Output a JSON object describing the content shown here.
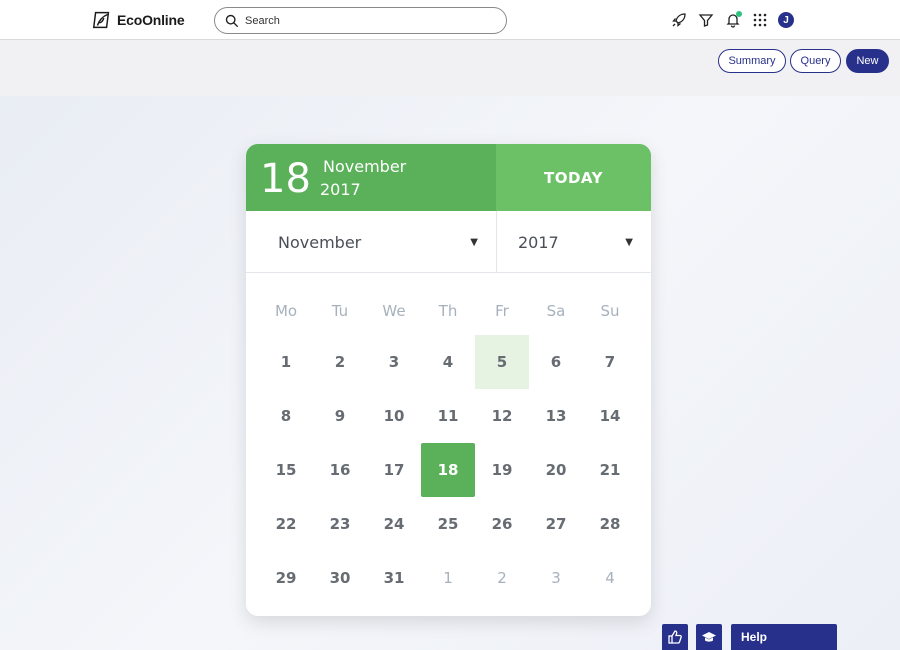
{
  "app": {
    "name": "EcoOnline"
  },
  "search": {
    "placeholder": "Search"
  },
  "topbar": {
    "icons": [
      "rocket-icon",
      "filter-icon",
      "bell-icon",
      "apps-grid-icon"
    ],
    "avatar_initial": "J",
    "notification_color": "#2ec27e"
  },
  "actions": {
    "summary": "Summary",
    "query": "Query",
    "new": "New"
  },
  "calendar": {
    "selected_day": "18",
    "selected_month": "November",
    "selected_year": "2017",
    "today_label": "TODAY",
    "month_select": "November",
    "year_select": "2017",
    "weekdays": [
      "Mo",
      "Tu",
      "We",
      "Th",
      "Fr",
      "Sa",
      "Su"
    ],
    "days": [
      {
        "n": "1"
      },
      {
        "n": "2"
      },
      {
        "n": "3"
      },
      {
        "n": "4"
      },
      {
        "n": "5",
        "state": "highlight"
      },
      {
        "n": "6"
      },
      {
        "n": "7"
      },
      {
        "n": "8"
      },
      {
        "n": "9"
      },
      {
        "n": "10"
      },
      {
        "n": "11"
      },
      {
        "n": "12"
      },
      {
        "n": "13"
      },
      {
        "n": "14"
      },
      {
        "n": "15"
      },
      {
        "n": "16"
      },
      {
        "n": "17"
      },
      {
        "n": "18",
        "state": "selected"
      },
      {
        "n": "19"
      },
      {
        "n": "20"
      },
      {
        "n": "21"
      },
      {
        "n": "22"
      },
      {
        "n": "23"
      },
      {
        "n": "24"
      },
      {
        "n": "25"
      },
      {
        "n": "26"
      },
      {
        "n": "27"
      },
      {
        "n": "28"
      },
      {
        "n": "29"
      },
      {
        "n": "30"
      },
      {
        "n": "31"
      },
      {
        "n": "1",
        "state": "other"
      },
      {
        "n": "2",
        "state": "other"
      },
      {
        "n": "3",
        "state": "other"
      },
      {
        "n": "4",
        "state": "other"
      }
    ],
    "colors": {
      "header": "#5bb05a",
      "today": "#6cc166",
      "highlight": "#e6f3e3",
      "muted": "#a7b1bd"
    }
  },
  "footer": {
    "help_label": "Help",
    "icons": [
      "thumbs-up-icon",
      "graduation-cap-icon"
    ]
  },
  "brand_color": "#27318b"
}
